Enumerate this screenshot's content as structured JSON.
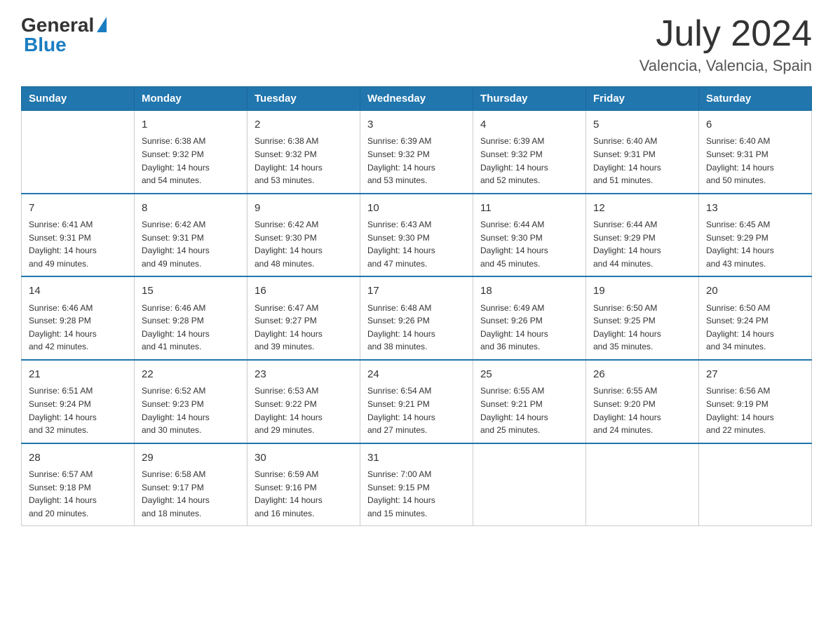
{
  "logo": {
    "general": "General",
    "blue": "Blue"
  },
  "title": {
    "month_year": "July 2024",
    "location": "Valencia, Valencia, Spain"
  },
  "weekdays": [
    "Sunday",
    "Monday",
    "Tuesday",
    "Wednesday",
    "Thursday",
    "Friday",
    "Saturday"
  ],
  "weeks": [
    [
      {
        "day": "",
        "info": ""
      },
      {
        "day": "1",
        "info": "Sunrise: 6:38 AM\nSunset: 9:32 PM\nDaylight: 14 hours\nand 54 minutes."
      },
      {
        "day": "2",
        "info": "Sunrise: 6:38 AM\nSunset: 9:32 PM\nDaylight: 14 hours\nand 53 minutes."
      },
      {
        "day": "3",
        "info": "Sunrise: 6:39 AM\nSunset: 9:32 PM\nDaylight: 14 hours\nand 53 minutes."
      },
      {
        "day": "4",
        "info": "Sunrise: 6:39 AM\nSunset: 9:32 PM\nDaylight: 14 hours\nand 52 minutes."
      },
      {
        "day": "5",
        "info": "Sunrise: 6:40 AM\nSunset: 9:31 PM\nDaylight: 14 hours\nand 51 minutes."
      },
      {
        "day": "6",
        "info": "Sunrise: 6:40 AM\nSunset: 9:31 PM\nDaylight: 14 hours\nand 50 minutes."
      }
    ],
    [
      {
        "day": "7",
        "info": "Sunrise: 6:41 AM\nSunset: 9:31 PM\nDaylight: 14 hours\nand 49 minutes."
      },
      {
        "day": "8",
        "info": "Sunrise: 6:42 AM\nSunset: 9:31 PM\nDaylight: 14 hours\nand 49 minutes."
      },
      {
        "day": "9",
        "info": "Sunrise: 6:42 AM\nSunset: 9:30 PM\nDaylight: 14 hours\nand 48 minutes."
      },
      {
        "day": "10",
        "info": "Sunrise: 6:43 AM\nSunset: 9:30 PM\nDaylight: 14 hours\nand 47 minutes."
      },
      {
        "day": "11",
        "info": "Sunrise: 6:44 AM\nSunset: 9:30 PM\nDaylight: 14 hours\nand 45 minutes."
      },
      {
        "day": "12",
        "info": "Sunrise: 6:44 AM\nSunset: 9:29 PM\nDaylight: 14 hours\nand 44 minutes."
      },
      {
        "day": "13",
        "info": "Sunrise: 6:45 AM\nSunset: 9:29 PM\nDaylight: 14 hours\nand 43 minutes."
      }
    ],
    [
      {
        "day": "14",
        "info": "Sunrise: 6:46 AM\nSunset: 9:28 PM\nDaylight: 14 hours\nand 42 minutes."
      },
      {
        "day": "15",
        "info": "Sunrise: 6:46 AM\nSunset: 9:28 PM\nDaylight: 14 hours\nand 41 minutes."
      },
      {
        "day": "16",
        "info": "Sunrise: 6:47 AM\nSunset: 9:27 PM\nDaylight: 14 hours\nand 39 minutes."
      },
      {
        "day": "17",
        "info": "Sunrise: 6:48 AM\nSunset: 9:26 PM\nDaylight: 14 hours\nand 38 minutes."
      },
      {
        "day": "18",
        "info": "Sunrise: 6:49 AM\nSunset: 9:26 PM\nDaylight: 14 hours\nand 36 minutes."
      },
      {
        "day": "19",
        "info": "Sunrise: 6:50 AM\nSunset: 9:25 PM\nDaylight: 14 hours\nand 35 minutes."
      },
      {
        "day": "20",
        "info": "Sunrise: 6:50 AM\nSunset: 9:24 PM\nDaylight: 14 hours\nand 34 minutes."
      }
    ],
    [
      {
        "day": "21",
        "info": "Sunrise: 6:51 AM\nSunset: 9:24 PM\nDaylight: 14 hours\nand 32 minutes."
      },
      {
        "day": "22",
        "info": "Sunrise: 6:52 AM\nSunset: 9:23 PM\nDaylight: 14 hours\nand 30 minutes."
      },
      {
        "day": "23",
        "info": "Sunrise: 6:53 AM\nSunset: 9:22 PM\nDaylight: 14 hours\nand 29 minutes."
      },
      {
        "day": "24",
        "info": "Sunrise: 6:54 AM\nSunset: 9:21 PM\nDaylight: 14 hours\nand 27 minutes."
      },
      {
        "day": "25",
        "info": "Sunrise: 6:55 AM\nSunset: 9:21 PM\nDaylight: 14 hours\nand 25 minutes."
      },
      {
        "day": "26",
        "info": "Sunrise: 6:55 AM\nSunset: 9:20 PM\nDaylight: 14 hours\nand 24 minutes."
      },
      {
        "day": "27",
        "info": "Sunrise: 6:56 AM\nSunset: 9:19 PM\nDaylight: 14 hours\nand 22 minutes."
      }
    ],
    [
      {
        "day": "28",
        "info": "Sunrise: 6:57 AM\nSunset: 9:18 PM\nDaylight: 14 hours\nand 20 minutes."
      },
      {
        "day": "29",
        "info": "Sunrise: 6:58 AM\nSunset: 9:17 PM\nDaylight: 14 hours\nand 18 minutes."
      },
      {
        "day": "30",
        "info": "Sunrise: 6:59 AM\nSunset: 9:16 PM\nDaylight: 14 hours\nand 16 minutes."
      },
      {
        "day": "31",
        "info": "Sunrise: 7:00 AM\nSunset: 9:15 PM\nDaylight: 14 hours\nand 15 minutes."
      },
      {
        "day": "",
        "info": ""
      },
      {
        "day": "",
        "info": ""
      },
      {
        "day": "",
        "info": ""
      }
    ]
  ]
}
